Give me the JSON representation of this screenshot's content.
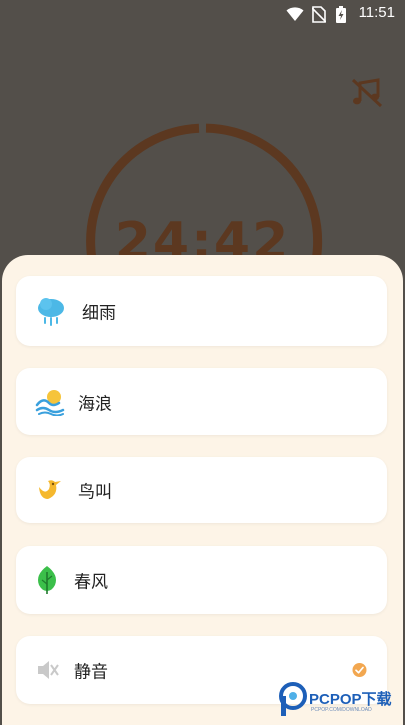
{
  "status_bar": {
    "time": "11:51",
    "icons": [
      "wifi-icon",
      "no-sim-icon",
      "battery-charging-icon"
    ]
  },
  "timer": {
    "display": "24:42",
    "ring_color": "#5c3820",
    "music_icon": "music-off-icon"
  },
  "sound_sheet": {
    "background": "#fdf4e7",
    "items": [
      {
        "label": "细雨",
        "icon": "drizzle-cloud-icon",
        "selected": false
      },
      {
        "label": "海浪",
        "icon": "sea-wave-icon",
        "selected": false
      },
      {
        "label": "鸟叫",
        "icon": "bird-icon",
        "selected": false
      },
      {
        "label": "春风",
        "icon": "leaf-icon",
        "selected": false
      },
      {
        "label": "静音",
        "icon": "mute-speaker-icon",
        "selected": true
      }
    ],
    "check_color": "#f2a750"
  },
  "watermark": {
    "text": "PCPOP下载",
    "subtext": "PCPOP.COM/DOWNLOAD"
  }
}
